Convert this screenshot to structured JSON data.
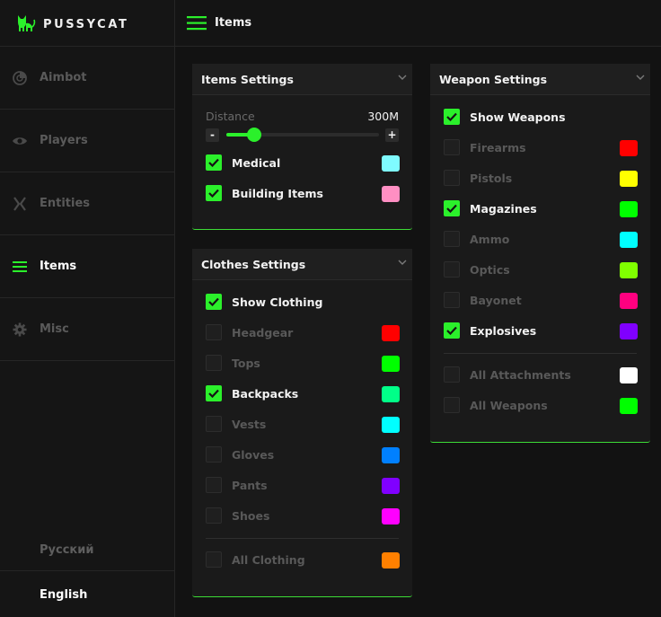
{
  "app": {
    "name": "PUSSYCAT"
  },
  "sidebar": {
    "items": [
      {
        "label": "Aimbot",
        "icon": "crosshair-icon",
        "active": false
      },
      {
        "label": "Players",
        "icon": "eye-icon",
        "active": false
      },
      {
        "label": "Entities",
        "icon": "x-entity-icon",
        "active": false
      },
      {
        "label": "Items",
        "icon": "list-icon",
        "active": true
      },
      {
        "label": "Misc",
        "icon": "gear-icon",
        "active": false
      }
    ],
    "languages": [
      {
        "label": "Русский",
        "active": false
      },
      {
        "label": "English",
        "active": true
      }
    ]
  },
  "header": {
    "title": "Items"
  },
  "colors": {
    "accent": "#2bf02b"
  },
  "items_settings": {
    "title": "Items Settings",
    "distance": {
      "label": "Distance",
      "value": "300M",
      "minus": "-",
      "plus": "+",
      "fraction": 0.18
    },
    "rows": [
      {
        "label": "Medical",
        "checked": true,
        "color": "#7ffbff"
      },
      {
        "label": "Building Items",
        "checked": true,
        "color": "#ff8fc3"
      }
    ]
  },
  "clothes_settings": {
    "title": "Clothes Settings",
    "rows": [
      {
        "label": "Show Clothing",
        "checked": true,
        "color": null
      },
      {
        "label": "Headgear",
        "checked": false,
        "color": "#ff0000"
      },
      {
        "label": "Tops",
        "checked": false,
        "color": "#00ff00"
      },
      {
        "label": "Backpacks",
        "checked": true,
        "color": "#00ff88"
      },
      {
        "label": "Vests",
        "checked": false,
        "color": "#00ffff"
      },
      {
        "label": "Gloves",
        "checked": false,
        "color": "#0080ff"
      },
      {
        "label": "Pants",
        "checked": false,
        "color": "#8000ff"
      },
      {
        "label": "Shoes",
        "checked": false,
        "color": "#ff00ff"
      }
    ],
    "footer_rows": [
      {
        "label": "All Clothing",
        "checked": false,
        "color": "#ff8000"
      }
    ]
  },
  "weapon_settings": {
    "title": "Weapon Settings",
    "rows": [
      {
        "label": "Show Weapons",
        "checked": true,
        "color": null
      },
      {
        "label": "Firearms",
        "checked": false,
        "color": "#ff0000"
      },
      {
        "label": "Pistols",
        "checked": false,
        "color": "#ffff00"
      },
      {
        "label": "Magazines",
        "checked": true,
        "color": "#00ff00"
      },
      {
        "label": "Ammo",
        "checked": false,
        "color": "#00ffff"
      },
      {
        "label": "Optics",
        "checked": false,
        "color": "#80ff00"
      },
      {
        "label": "Bayonet",
        "checked": false,
        "color": "#ff0080"
      },
      {
        "label": "Explosives",
        "checked": true,
        "color": "#8000ff"
      }
    ],
    "footer_rows": [
      {
        "label": "All Attachments",
        "checked": false,
        "color": "#ffffff"
      },
      {
        "label": "All Weapons",
        "checked": false,
        "color": "#00ff00"
      }
    ]
  }
}
